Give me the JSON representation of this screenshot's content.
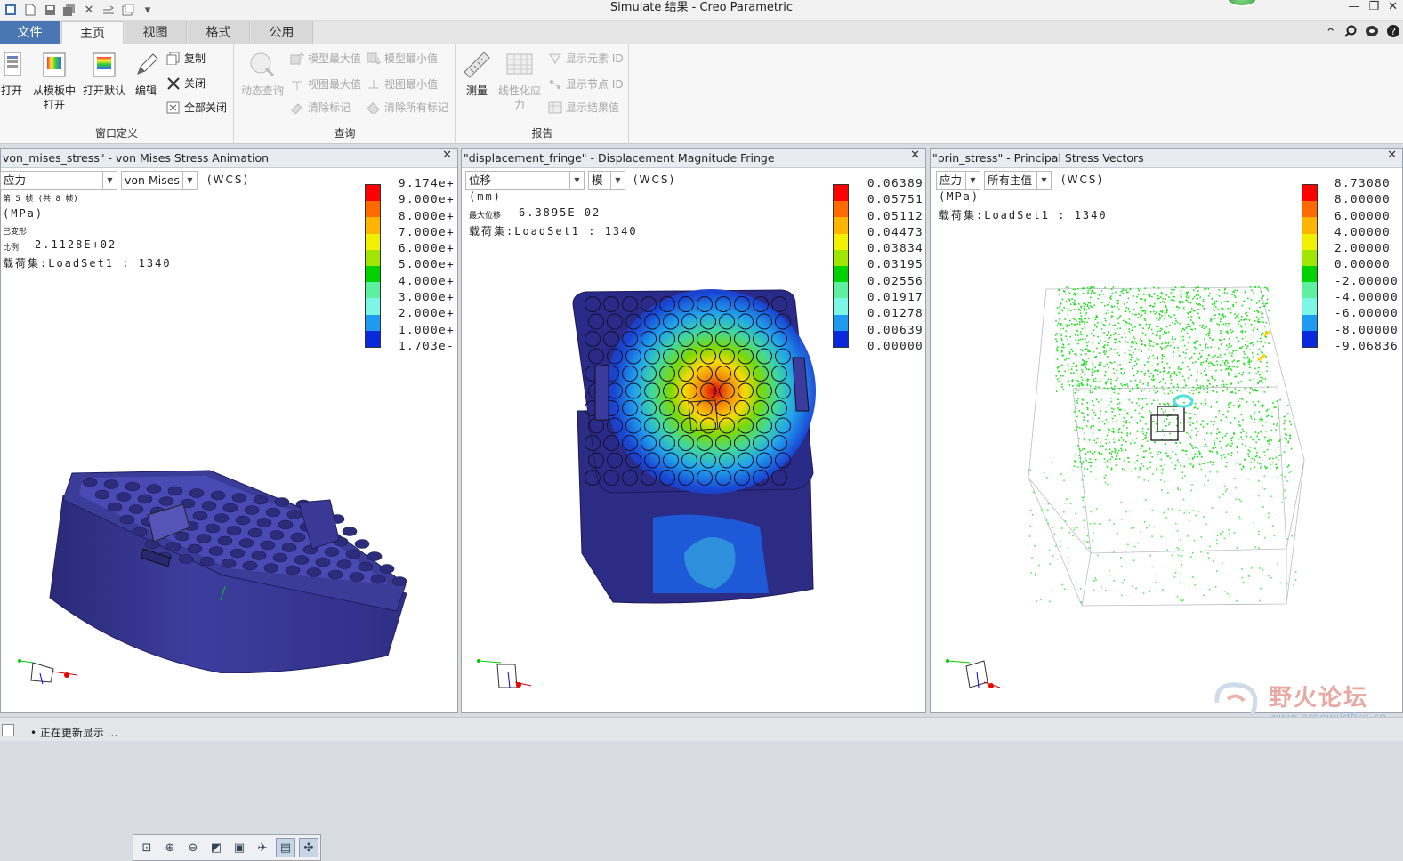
{
  "window": {
    "title": "Simulate 结果 - Creo Parametric"
  },
  "tabs": [
    {
      "label": "文件"
    },
    {
      "label": "主页"
    },
    {
      "label": "视图"
    },
    {
      "label": "格式"
    },
    {
      "label": "公用"
    }
  ],
  "ribbon": {
    "window_group": {
      "label": "窗口定义",
      "open": "打开",
      "open_template_1": "从模板中",
      "open_template_2": "打开",
      "open_default": "打开默认",
      "edit": "编辑",
      "copy": "复制",
      "close": "关闭",
      "close_all": "全部关闭"
    },
    "query_group": {
      "label": "查询",
      "dynamic_query": "动态查询",
      "model_max": "模型最大值",
      "model_min": "模型最小值",
      "view_max": "视图最大值",
      "view_min": "视图最小值",
      "clear_marks": "清除标记",
      "clear_all_marks": "清除所有标记"
    },
    "report_group": {
      "label": "报告",
      "measure": "测量",
      "linearize_1": "线性化应",
      "linearize_2": "力",
      "show_element_id": "显示元素 ID",
      "show_node_id": "显示节点 ID",
      "show_result_table": "显示结果值"
    }
  },
  "panels": [
    {
      "title": "von_mises_stress\" - von Mises Stress Animation",
      "quantity": "应力",
      "component": "von Mises",
      "wcs": "(WCS)",
      "frame": "第 5 帧 (共 8 帧)",
      "units": "(MPa)",
      "deformed": "已变形",
      "scale_label": "比例",
      "scale_value": "2.1128E+02",
      "loadset": "载荷集:LoadSet1 : 1340",
      "legend_values": [
        "9.174e+",
        "9.000e+",
        "8.000e+",
        "7.000e+",
        "6.000e+",
        "5.000e+",
        "4.000e+",
        "3.000e+",
        "2.000e+",
        "1.000e+",
        "1.703e-"
      ]
    },
    {
      "title": "\"displacement_fringe\" - Displacement Magnitude Fringe",
      "quantity": "位移",
      "component": "模",
      "wcs": "(WCS)",
      "units": "(mm)",
      "max_label": "最大位移",
      "max_value": "6.3895E-02",
      "loadset": "载荷集:LoadSet1 : 1340",
      "legend_values": [
        "0.06389",
        "0.05751",
        "0.05112",
        "0.04473",
        "0.03834",
        "0.03195",
        "0.02556",
        "0.01917",
        "0.01278",
        "0.00639",
        "0.00000"
      ]
    },
    {
      "title": "\"prin_stress\" - Principal Stress Vectors",
      "quantity": "应力",
      "component": "所有主值",
      "wcs": "(WCS)",
      "units": "(MPa)",
      "loadset": "载荷集:LoadSet1 : 1340",
      "legend_values": [
        "8.73080",
        "8.00000",
        "6.00000",
        "4.00000",
        "2.00000",
        "0.00000",
        "-2.00000",
        "-4.00000",
        "-6.00000",
        "-8.00000",
        "-9.06836"
      ]
    }
  ],
  "legend_colors": [
    "#ff0000",
    "#ff6a00",
    "#ffb400",
    "#f0f000",
    "#a0e600",
    "#00d200",
    "#5ef0a0",
    "#7ef6e6",
    "#1e9bf0",
    "#0a28dc",
    "#28287a"
  ],
  "statusbar": {
    "message": "• 正在更新显示 ..."
  },
  "watermark": {
    "text": "野火论坛",
    "url": "www.proewildfire.cn"
  },
  "icons": [
    "new-icon",
    "save-icon",
    "close-window-icon",
    "undo-icon",
    "zoom-icon",
    "refit-icon",
    "help-icon"
  ]
}
